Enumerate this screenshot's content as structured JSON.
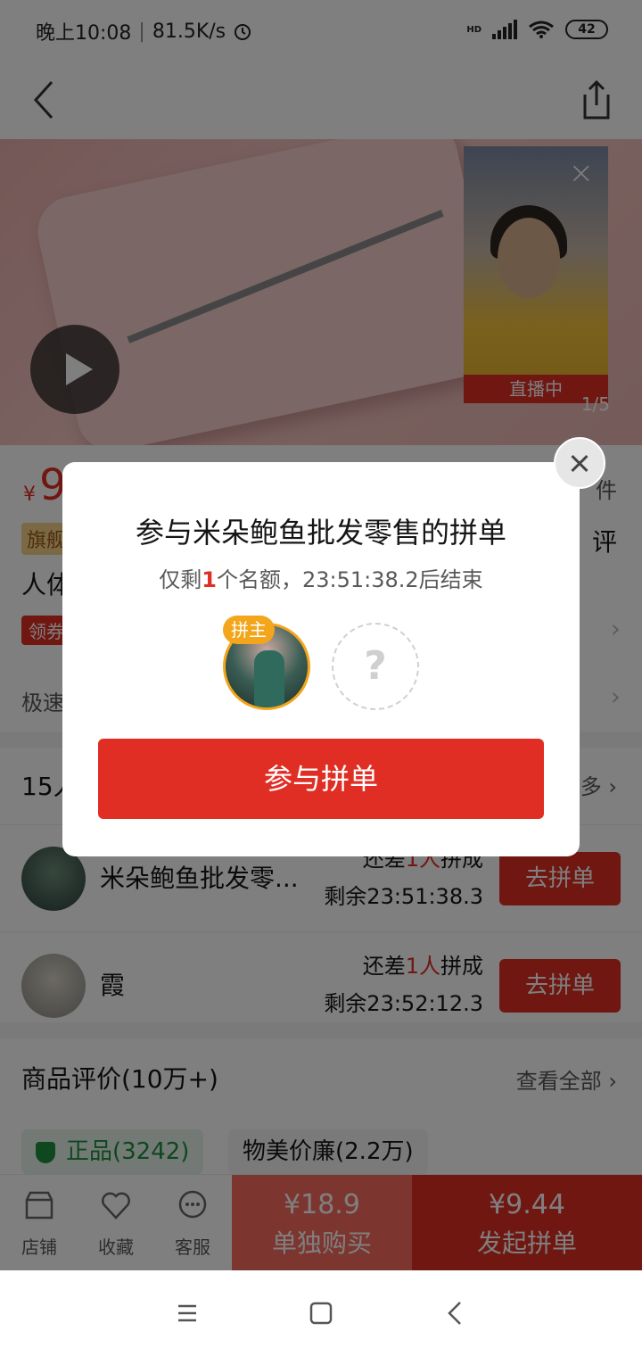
{
  "status_bar": {
    "time": "晚上10:08",
    "speed": "81.5K/s",
    "network": "HD",
    "battery": "42"
  },
  "media": {
    "live_label": "直播中",
    "page_indicator": "1/5"
  },
  "product": {
    "price_yen": "¥",
    "price_partial": "9",
    "sold_partial": "件",
    "flagship_partial": "旗舰",
    "rating_partial": "评",
    "title_partial": "人体",
    "coupon_partial": "领券",
    "fast_partial": "极速"
  },
  "groups": {
    "count_partial": "15人",
    "more_partial": "多",
    "rows": [
      {
        "name": "米朵鲍鱼批发零...",
        "need_prefix": "还差",
        "need_count": "1人",
        "need_suffix": "拼成",
        "remain": "剩余23:51:38.3",
        "button": "去拼单"
      },
      {
        "name": "霞",
        "need_prefix": "还差",
        "need_count": "1人",
        "need_suffix": "拼成",
        "remain": "剩余23:52:12.3",
        "button": "去拼单"
      }
    ]
  },
  "reviews": {
    "title": "商品评价(10万+)",
    "view_all": "查看全部",
    "tags": [
      "正品(3242)",
      "物美价廉(2.2万)"
    ]
  },
  "action_bar": {
    "store": "店铺",
    "favorite": "收藏",
    "service": "客服",
    "single_price": "¥18.9",
    "single_label": "单独购买",
    "group_price": "¥9.44",
    "group_label": "发起拼单"
  },
  "modal": {
    "title": "参与米朵鲍鱼批发零售的拼单",
    "sub_prefix": "仅剩",
    "sub_count": "1",
    "sub_suffix": "个名额，23:51:38.2后结束",
    "leader_badge": "拼主",
    "empty_slot": "?",
    "join_button": "参与拼单"
  },
  "colors": {
    "brand_red": "#e02e24",
    "leader_orange": "#f3a51b",
    "overlay": "rgba(0,0,0,0.5)"
  }
}
